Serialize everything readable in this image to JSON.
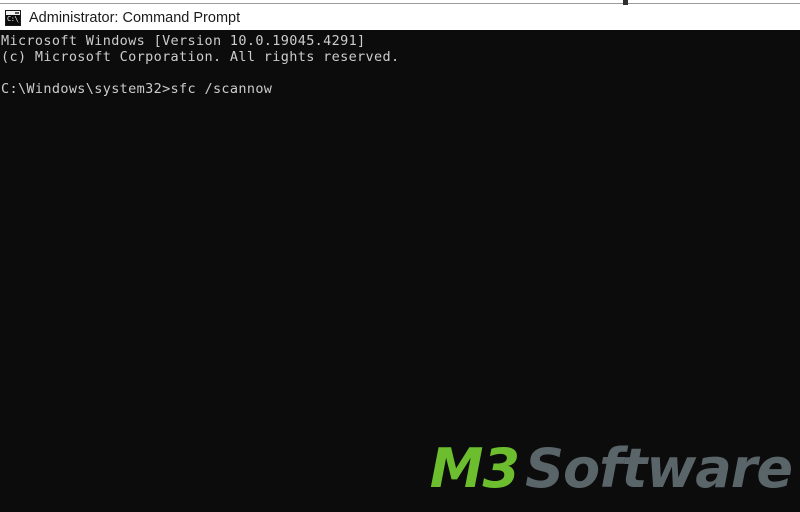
{
  "window": {
    "icon": "cmd-console-icon",
    "icon_glyph": "C:\\_",
    "title": "Administrator: Command Prompt"
  },
  "console": {
    "background_color": "#0c0c0c",
    "text_color": "#cccccc",
    "lines": [
      "Microsoft Windows [Version 10.0.19045.4291]",
      "(c) Microsoft Corporation. All rights reserved.",
      "",
      "C:\\Windows\\system32>sfc /scannow"
    ],
    "text": "Microsoft Windows [Version 10.0.19045.4291]\n(c) Microsoft Corporation. All rights reserved.\n\nC:\\Windows\\system32>sfc /scannow",
    "os_name": "Microsoft Windows",
    "os_version": "10.0.19045.4291",
    "copyright": "(c) Microsoft Corporation. All rights reserved.",
    "prompt_path": "C:\\Windows\\system32>",
    "command": "sfc /scannow"
  },
  "watermark": {
    "brand_primary": "M3",
    "brand_secondary": "Software",
    "primary_color": "#6cbe2e",
    "secondary_color": "#5a656a"
  }
}
